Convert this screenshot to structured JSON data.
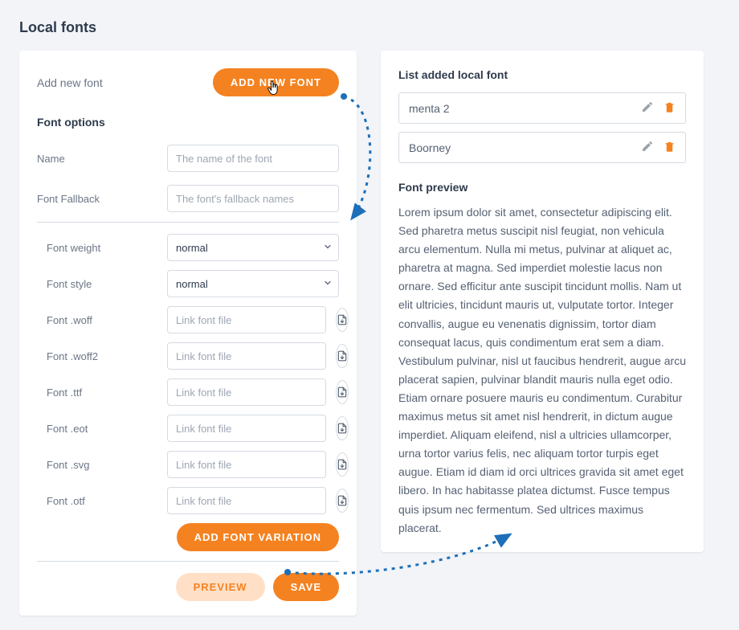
{
  "page_title": "Local fonts",
  "left": {
    "add_new_font_label": "Add new font",
    "add_new_font_button": "ADD NEW FONT",
    "font_options_head": "Font options",
    "name_label": "Name",
    "name_placeholder": "The name of the font",
    "fallback_label": "Font Fallback",
    "fallback_placeholder": "The font's fallback names",
    "weight_label": "Font weight",
    "weight_value": "normal",
    "style_label": "Font style",
    "style_value": "normal",
    "file_placeholder": "Link font file",
    "file_rows": [
      {
        "label": "Font .woff"
      },
      {
        "label": "Font .woff2"
      },
      {
        "label": "Font .ttf"
      },
      {
        "label": "Font .eot"
      },
      {
        "label": "Font .svg"
      },
      {
        "label": "Font .otf"
      }
    ],
    "add_variation_button": "ADD FONT VARIATION",
    "preview_button": "PREVIEW",
    "save_button": "SAVE"
  },
  "right": {
    "list_head": "List added local font",
    "items": [
      {
        "name": "menta 2"
      },
      {
        "name": "Boorney"
      }
    ],
    "preview_head": "Font preview",
    "preview_text": "Lorem ipsum dolor sit amet, consectetur adipiscing elit. Sed pharetra metus suscipit nisl feugiat, non vehicula arcu elementum. Nulla mi metus, pulvinar at aliquet ac, pharetra at magna. Sed imperdiet molestie lacus non ornare. Sed efficitur ante suscipit tincidunt mollis. Nam ut elit ultricies, tincidunt mauris ut, vulputate tortor. Integer convallis, augue eu venenatis dignissim, tortor diam consequat lacus, quis condimentum erat sem a diam. Vestibulum pulvinar, nisl ut faucibus hendrerit, augue arcu placerat sapien, pulvinar blandit mauris nulla eget odio. Etiam ornare posuere mauris eu condimentum. Curabitur maximus metus sit amet nisl hendrerit, in dictum augue imperdiet. Aliquam eleifend, nisl a ultricies ullamcorper, urna tortor varius felis, nec aliquam tortor turpis eget augue. Etiam id diam id orci ultrices gravida sit amet eget libero. In hac habitasse platea dictumst. Fusce tempus quis ipsum nec fermentum. Sed ultrices maximus placerat."
  },
  "colors": {
    "accent": "#f58220"
  }
}
